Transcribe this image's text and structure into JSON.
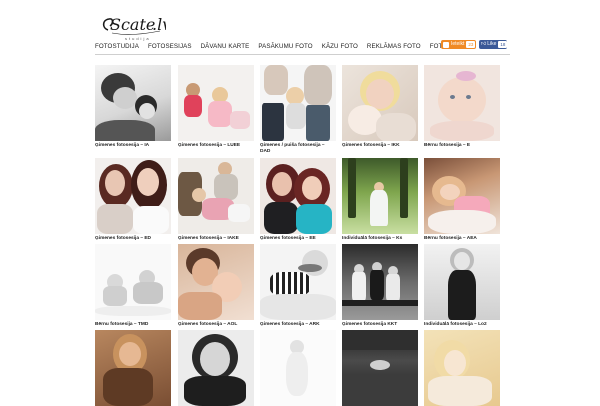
{
  "brand": {
    "logo_text": "Scate.lv",
    "logo_subtext": "studija"
  },
  "nav": {
    "items": [
      {
        "label": "FOTOSTUDIJA"
      },
      {
        "label": "FOTOSESIJAS"
      },
      {
        "label": "DĀVANU KARTE"
      },
      {
        "label": "PASĀKUMU FOTO"
      },
      {
        "label": "KĀZU FOTO"
      },
      {
        "label": "REKLĀMAS FOTO"
      },
      {
        "label": "FOTOBLOGS"
      }
    ]
  },
  "social": {
    "rss_label": "Ieteikt",
    "rss_count": "23",
    "fb_label": "Like",
    "fb_count": "18"
  },
  "gallery": {
    "items": [
      {
        "caption": "Ģimenes fotosesija – IA"
      },
      {
        "caption": "Ģimenes fotosesija – LUEE"
      },
      {
        "caption": "Ģimenes / puiša fotosesija – DAD"
      },
      {
        "caption": "Ģimenes fotosesija – IKK"
      },
      {
        "caption": "Bērnu fotosesija – E"
      },
      {
        "caption": "Ģimenes fotosesija – ED"
      },
      {
        "caption": "Ģimenes fotosesija – IAKE"
      },
      {
        "caption": "Ģimenes fotosesija – EE"
      },
      {
        "caption": "Individuālā fotosesija – Ks"
      },
      {
        "caption": "Bērnu fotosesija – AEA"
      },
      {
        "caption": "Bērnu fotosesija – TMD"
      },
      {
        "caption": "Ģimenes fotosesija – AOL"
      },
      {
        "caption": "Ģimenes fotosesija – ARK"
      },
      {
        "caption": "Ģimenes fotosesija KKT"
      },
      {
        "caption": "Individuālā fotosesija – Lo2"
      },
      {
        "caption": ""
      },
      {
        "caption": ""
      },
      {
        "caption": ""
      },
      {
        "caption": ""
      },
      {
        "caption": ""
      }
    ]
  }
}
